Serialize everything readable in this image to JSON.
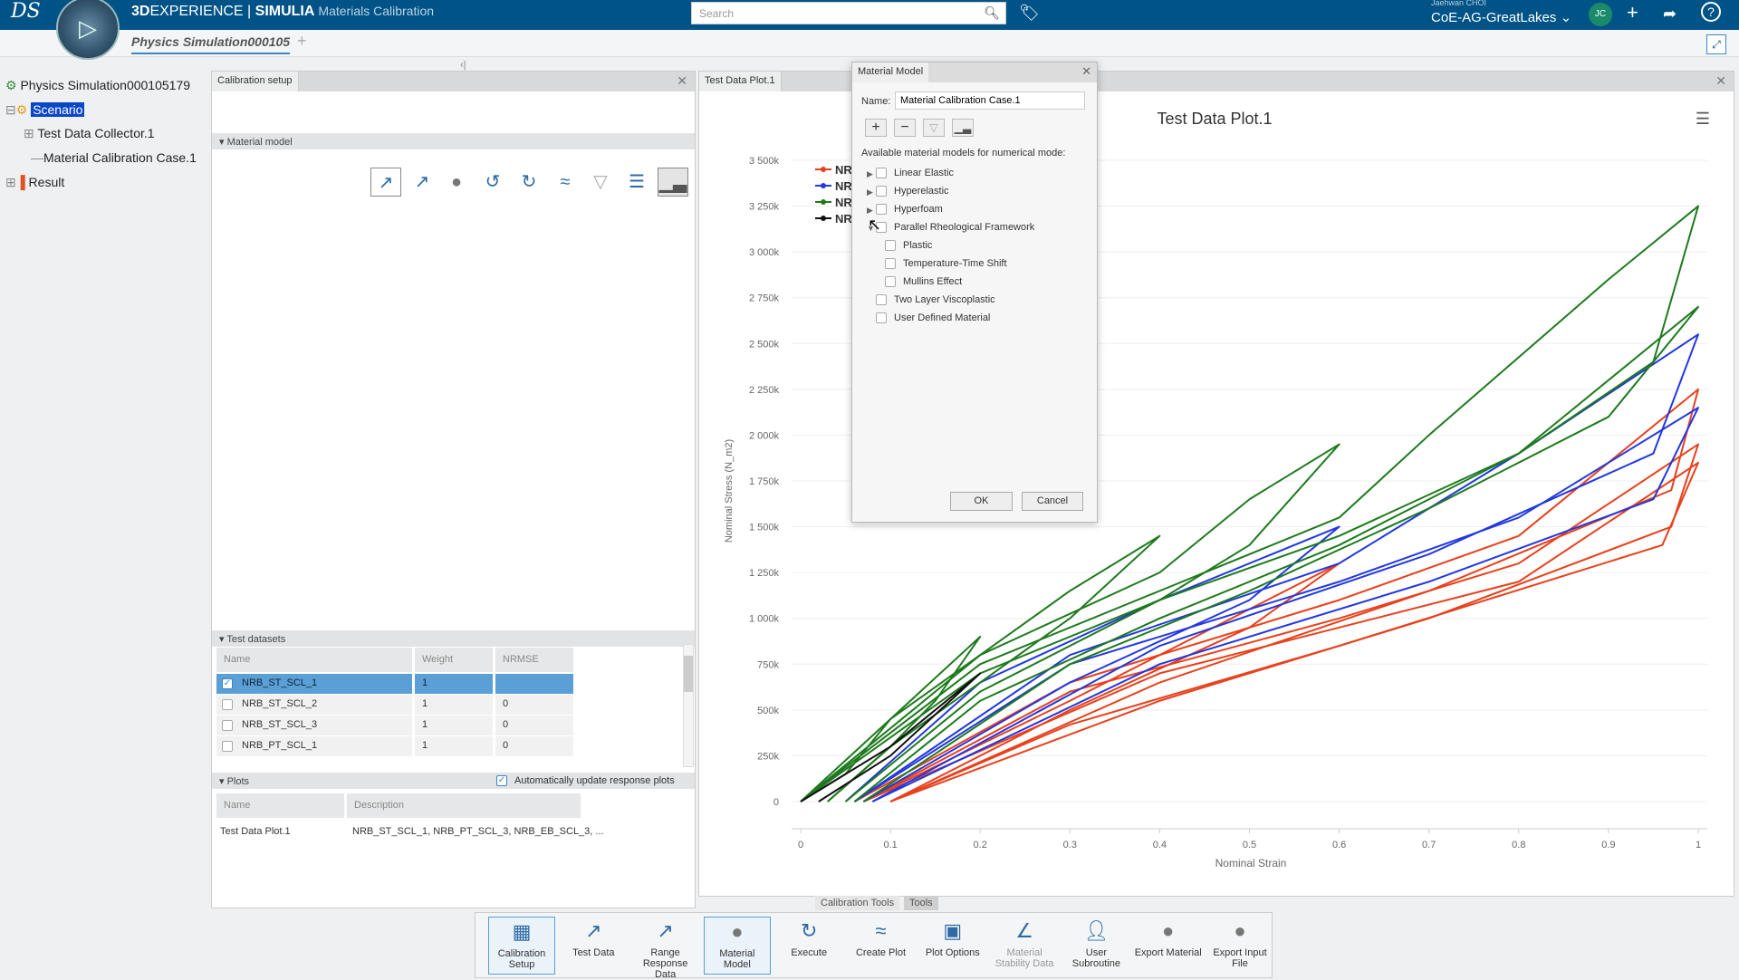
{
  "app": {
    "brand_bold_prefix": "3D",
    "brand_rest": "EXPERIENCE | ",
    "brand_simulia": "SIMULIA",
    "brand_app": "Materials Calibration",
    "search_placeholder": "Search",
    "user_name": "Jaehwan CHOI",
    "workspace": "CoE-AG-GreatLakes",
    "avatar_initials": "JC",
    "accent": "#005386"
  },
  "tabs": [
    {
      "label": "Physics Simulation000105",
      "active": true
    }
  ],
  "tree": {
    "root": "Physics Simulation000105179",
    "items": [
      {
        "label": "Scenario",
        "selected": true
      },
      {
        "label": "Test Data Collector.1"
      },
      {
        "label": "Material Calibration Case.1"
      },
      {
        "label": "Result"
      }
    ]
  },
  "calibration_panel": {
    "tab": "Calibration setup",
    "material_section": "Material model",
    "datasets_section": "Test datasets",
    "datasets_columns": [
      "Name",
      "Weight",
      "NRMSE"
    ],
    "datasets": [
      {
        "name": "NRB_ST_SCL_1",
        "weight": "1",
        "nrmse": "",
        "checked": true,
        "selected": true
      },
      {
        "name": "NRB_ST_SCL_2",
        "weight": "1",
        "nrmse": "0",
        "checked": false
      },
      {
        "name": "NRB_ST_SCL_3",
        "weight": "1",
        "nrmse": "0",
        "checked": false
      },
      {
        "name": "NRB_PT_SCL_1",
        "weight": "1",
        "nrmse": "0",
        "checked": false
      }
    ],
    "plots_section": "Plots",
    "auto_update_label": "Automatically update response plots",
    "auto_update_checked": true,
    "plots_columns": [
      "Name",
      "Description"
    ],
    "plots": [
      {
        "name": "Test Data Plot.1",
        "description": "NRB_ST_SCL_1, NRB_PT_SCL_3, NRB_EB_SCL_3, ..."
      }
    ]
  },
  "plot_panel": {
    "tab": "Test Data Plot.1"
  },
  "chart_data": {
    "type": "line",
    "title": "Test Data Plot.1",
    "xlabel": "Nominal Strain",
    "ylabel": "Nominal Stress (N_m2)",
    "xlim": [
      0,
      1
    ],
    "ylim": [
      0,
      3500
    ],
    "y_unit_suffix": "k",
    "x_ticks": [
      "0",
      "0.1",
      "0.2",
      "0.3",
      "0.4",
      "0.5",
      "0.6",
      "0.7",
      "0.8",
      "0.9",
      "1"
    ],
    "y_ticks": [
      "0",
      "250k",
      "500k",
      "750k",
      "1 000k",
      "1 250k",
      "1 500k",
      "1 750k",
      "2 000k",
      "2 250k",
      "2 500k",
      "2 750k",
      "3 000k",
      "3 250k",
      "3 500k"
    ],
    "legend_position": "top-left",
    "grid": "horizontal",
    "series": [
      {
        "name": "NR",
        "color": "#e8401c",
        "cycles": [
          [
            [
              0.06,
              0
            ],
            [
              0.3,
              650
            ],
            [
              0.6,
              1100
            ],
            [
              0.8,
              1450
            ],
            [
              1.0,
              2250
            ],
            [
              0.97,
              1700
            ],
            [
              0.7,
              1150
            ],
            [
              0.4,
              650
            ],
            [
              0.1,
              0
            ]
          ],
          [
            [
              0.07,
              0
            ],
            [
              0.3,
              600
            ],
            [
              0.6,
              1000
            ],
            [
              0.8,
              1300
            ],
            [
              1.0,
              1950
            ],
            [
              0.97,
              1500
            ],
            [
              0.7,
              1000
            ],
            [
              0.4,
              550
            ],
            [
              0.1,
              0
            ]
          ],
          [
            [
              0.07,
              0
            ],
            [
              0.3,
              550
            ],
            [
              0.6,
              1300
            ],
            [
              0.5,
              950
            ],
            [
              0.3,
              500
            ],
            [
              0.1,
              0
            ]
          ],
          [
            [
              0.07,
              0
            ],
            [
              0.4,
              700
            ],
            [
              0.8,
              1200
            ],
            [
              1.0,
              1850
            ],
            [
              0.96,
              1400
            ],
            [
              0.6,
              850
            ],
            [
              0.3,
              420
            ],
            [
              0.1,
              0
            ]
          ]
        ]
      },
      {
        "name": "NR",
        "color": "#2238e0",
        "cycles": [
          [
            [
              0.05,
              0
            ],
            [
              0.2,
              650
            ],
            [
              0.4,
              1100
            ],
            [
              0.6,
              1500
            ],
            [
              0.5,
              1100
            ],
            [
              0.3,
              650
            ],
            [
              0.07,
              0
            ]
          ],
          [
            [
              0.06,
              0
            ],
            [
              0.3,
              800
            ],
            [
              0.6,
              1300
            ],
            [
              0.8,
              1900
            ],
            [
              1.0,
              2550
            ],
            [
              0.95,
              1900
            ],
            [
              0.7,
              1350
            ],
            [
              0.4,
              850
            ],
            [
              0.08,
              0
            ]
          ],
          [
            [
              0.06,
              0
            ],
            [
              0.3,
              750
            ],
            [
              0.6,
              1200
            ],
            [
              0.8,
              1550
            ],
            [
              1.0,
              2150
            ],
            [
              0.95,
              1650
            ],
            [
              0.7,
              1200
            ],
            [
              0.4,
              750
            ],
            [
              0.08,
              0
            ]
          ]
        ]
      },
      {
        "name": "NR",
        "color": "#1e7a1e",
        "cycles": [
          [
            [
              0,
              0
            ],
            [
              0.05,
              150
            ],
            [
              0.1,
              450
            ],
            [
              0.2,
              900
            ],
            [
              0.15,
              550
            ],
            [
              0.1,
              300
            ],
            [
              0.03,
              0
            ]
          ],
          [
            [
              0,
              0
            ],
            [
              0.1,
              450
            ],
            [
              0.2,
              800
            ],
            [
              0.3,
              1150
            ],
            [
              0.4,
              1450
            ],
            [
              0.3,
              1000
            ],
            [
              0.2,
              650
            ],
            [
              0.1,
              300
            ],
            [
              0.03,
              0
            ]
          ],
          [
            [
              0,
              0
            ],
            [
              0.2,
              800
            ],
            [
              0.4,
              1250
            ],
            [
              0.5,
              1650
            ],
            [
              0.6,
              1950
            ],
            [
              0.5,
              1400
            ],
            [
              0.4,
              1100
            ],
            [
              0.2,
              600
            ],
            [
              0.05,
              0
            ]
          ],
          [
            [
              0,
              0
            ],
            [
              0.2,
              750
            ],
            [
              0.4,
              1150
            ],
            [
              0.6,
              1550
            ],
            [
              0.7,
              2000
            ],
            [
              0.9,
              2850
            ],
            [
              1.0,
              3250
            ],
            [
              0.95,
              2400
            ],
            [
              0.8,
              1900
            ],
            [
              0.6,
              1400
            ],
            [
              0.4,
              1000
            ],
            [
              0.2,
              550
            ],
            [
              0.06,
              0
            ]
          ],
          [
            [
              0,
              0
            ],
            [
              0.2,
              700
            ],
            [
              0.4,
              1100
            ],
            [
              0.6,
              1450
            ],
            [
              0.8,
              1900
            ],
            [
              1.0,
              2700
            ],
            [
              0.9,
              2100
            ],
            [
              0.7,
              1600
            ],
            [
              0.5,
              1150
            ],
            [
              0.3,
              750
            ],
            [
              0.07,
              0
            ]
          ]
        ]
      },
      {
        "name": "NR",
        "color": "#111111",
        "cycles": [
          [
            [
              0,
              0
            ],
            [
              0.1,
              300
            ],
            [
              0.2,
              700
            ],
            [
              0.1,
              250
            ],
            [
              0.02,
              0
            ]
          ]
        ]
      }
    ]
  },
  "dialog": {
    "title": "Material Model",
    "name_label": "Name:",
    "name_value": "Material Calibration Case.1",
    "list_label": "Available material models for numerical mode:",
    "models": [
      {
        "label": "Linear Elastic",
        "expandable": true
      },
      {
        "label": "Hyperelastic",
        "expandable": true
      },
      {
        "label": "Hyperfoam",
        "expandable": true
      },
      {
        "label": "Parallel Rheological Framework",
        "expandable": true,
        "expanded": true
      },
      {
        "label": "Plastic",
        "child": true
      },
      {
        "label": "Temperature-Time Shift",
        "child": true
      },
      {
        "label": "Mullins Effect",
        "child": true
      },
      {
        "label": "Two Layer Viscoplastic"
      },
      {
        "label": "User Defined Material"
      }
    ],
    "ok": "OK",
    "cancel": "Cancel"
  },
  "bottom_tabs": [
    "Calibration Tools",
    "Tools"
  ],
  "tools": [
    {
      "label": "Calibration Setup",
      "icon": "table-icon",
      "active": true
    },
    {
      "label": "Test Data",
      "icon": "stress-strain-icon"
    },
    {
      "label": "Range Response Data",
      "icon": "range-data-icon"
    },
    {
      "label": "Material Model",
      "icon": "material-sphere-icon",
      "active": true
    },
    {
      "label": "Execute",
      "icon": "execute-icon"
    },
    {
      "label": "Create Plot",
      "icon": "plot-icon"
    },
    {
      "label": "Plot Options",
      "icon": "plot-options-icon"
    },
    {
      "label": "Material Stability Data",
      "icon": "stability-icon",
      "disabled": true
    },
    {
      "label": "User Subroutine",
      "icon": "user-subroutine-icon"
    },
    {
      "label": "Export Material",
      "icon": "export-material-icon"
    },
    {
      "label": "Export Input File",
      "icon": "export-file-icon"
    }
  ]
}
